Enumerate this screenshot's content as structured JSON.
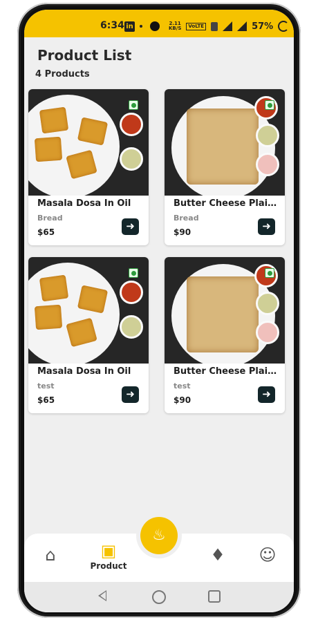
{
  "status_bar": {
    "time": "6:34",
    "speed_top": "2.11",
    "speed_bottom": "KB/S",
    "volte": "VoLTE",
    "battery": "57%"
  },
  "page": {
    "title": "Product List",
    "count": "4 Products"
  },
  "products": [
    {
      "name": "Masala Dosa In Oil",
      "category": "Bread",
      "price": "$65",
      "image": "masala-dosa"
    },
    {
      "name": "Butter Cheese Plain P...",
      "category": "Bread",
      "price": "$90",
      "image": "plain-dosa"
    },
    {
      "name": "Masala Dosa In Oil",
      "category": "test",
      "price": "$65",
      "image": "masala-dosa"
    },
    {
      "name": "Butter Cheese Plain P...",
      "category": "test",
      "price": "$90",
      "image": "plain-dosa"
    }
  ],
  "bottom_nav": {
    "home_icon": "home-icon",
    "product_label": "Product",
    "product_icon": "archive-box-icon",
    "fab_icon": "flame-icon",
    "notifications_icon": "bell-icon",
    "profile_icon": "user-icon"
  },
  "colors": {
    "accent": "#f5c200",
    "button_dark": "#13262a",
    "background": "#efefef"
  }
}
